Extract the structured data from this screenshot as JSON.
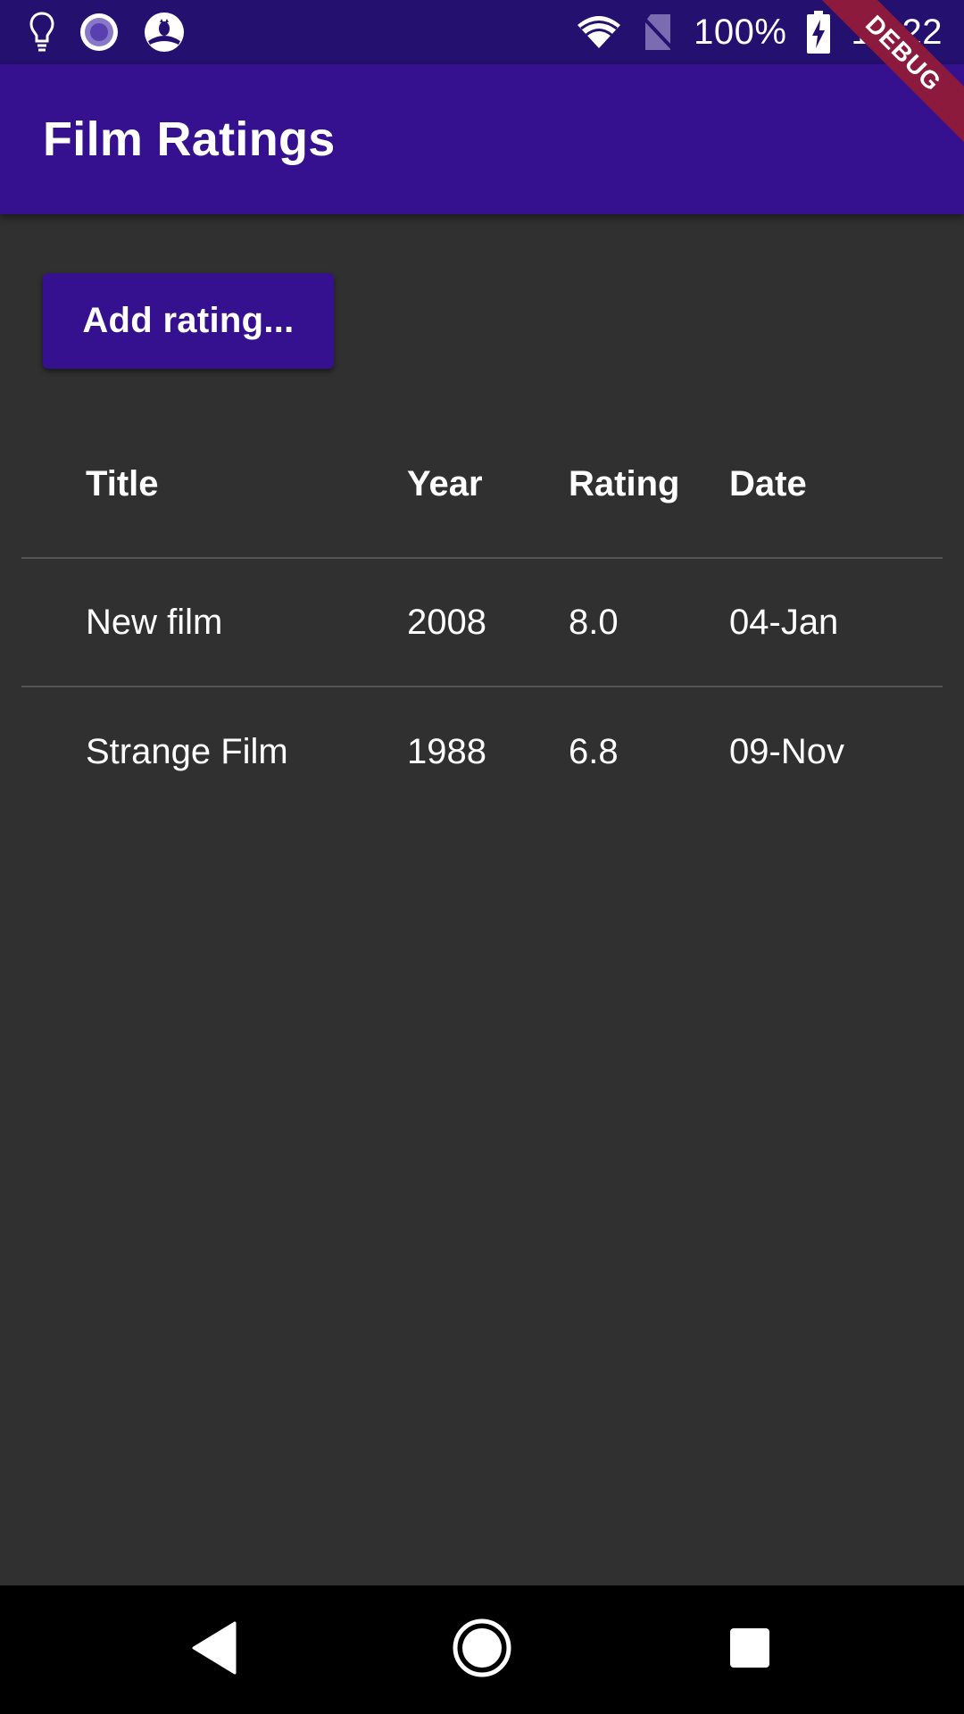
{
  "status_bar": {
    "battery_percent": "100%",
    "time": "17:22",
    "left_icons": [
      "lightbulb-icon",
      "radio-circle-icon",
      "owl-icon"
    ],
    "right_icons": [
      "wifi-icon",
      "no-sim-icon",
      "battery-charging-icon"
    ]
  },
  "debug_banner": "DEBUG",
  "app_bar": {
    "title": "Film Ratings"
  },
  "add_button": {
    "label": "Add rating..."
  },
  "table": {
    "headers": {
      "title": "Title",
      "year": "Year",
      "rating": "Rating",
      "date": "Date"
    },
    "rows": [
      {
        "title": "New film",
        "year": "2008",
        "rating": "8.0",
        "date": "04-Jan"
      },
      {
        "title": "Strange Film",
        "year": "1988",
        "rating": "6.8",
        "date": "09-Nov"
      }
    ]
  },
  "nav_bar": {
    "buttons": [
      "back-icon",
      "home-icon",
      "recents-icon"
    ]
  },
  "colors": {
    "status_bar": "#24106e",
    "primary": "#35108f",
    "background": "#303030",
    "divider": "#545454",
    "debug_banner": "#8b1a3d",
    "nav_bar": "#000000"
  }
}
